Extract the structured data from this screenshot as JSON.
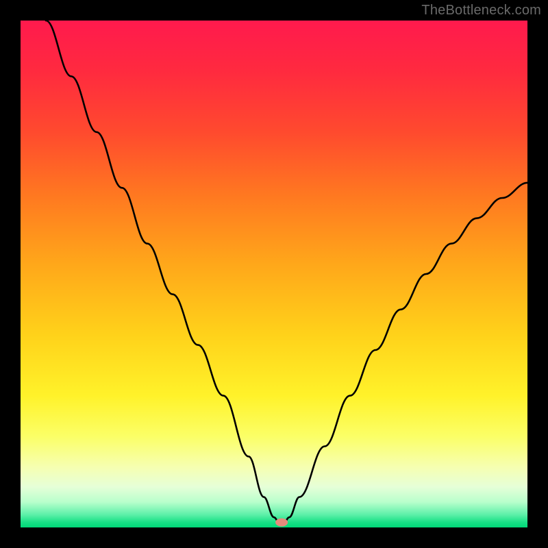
{
  "watermark": "TheBottleneck.com",
  "chart_data": {
    "type": "line",
    "title": "",
    "xlabel": "",
    "ylabel": "",
    "xlim": [
      0,
      100
    ],
    "ylim": [
      0,
      100
    ],
    "grid": false,
    "series": [
      {
        "name": "bottleneck-curve",
        "x": [
          5,
          10,
          15,
          20,
          25,
          30,
          35,
          40,
          45,
          48,
          50,
          51,
          52,
          53,
          55,
          60,
          65,
          70,
          75,
          80,
          85,
          90,
          95,
          100
        ],
        "y": [
          100,
          89,
          78,
          67,
          56,
          46,
          36,
          26,
          14,
          6,
          2,
          1,
          1,
          2,
          6,
          16,
          26,
          35,
          43,
          50,
          56,
          61,
          65,
          68
        ]
      }
    ],
    "annotations": [
      {
        "name": "minimum-marker",
        "x": 51.5,
        "y": 1,
        "color": "#e58b7c"
      }
    ],
    "background_gradient": {
      "top": "#ff1a4d",
      "mid": "#fff22a",
      "bottom": "#00d878"
    }
  }
}
